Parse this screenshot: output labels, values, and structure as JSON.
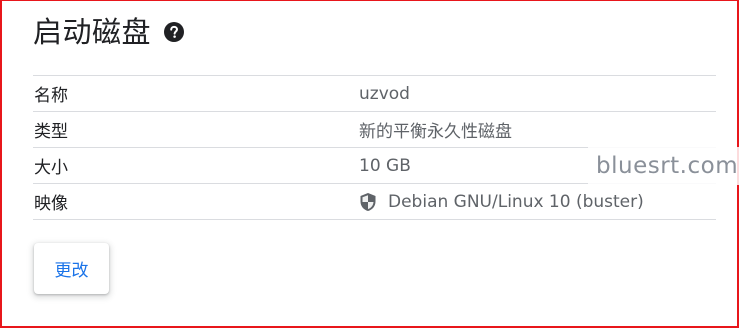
{
  "header": {
    "title": "启动磁盘",
    "help_icon": "help-circle-icon"
  },
  "disk": {
    "rows": [
      {
        "label": "名称",
        "value": "uzvod"
      },
      {
        "label": "类型",
        "value": "新的平衡永久性磁盘"
      },
      {
        "label": "大小",
        "value": "10 GB"
      },
      {
        "label": "映像",
        "value": "Debian GNU/Linux 10 (buster)",
        "icon": "shield-icon"
      }
    ]
  },
  "actions": {
    "edit_label": "更改"
  },
  "watermark": {
    "text": "bluesrt.com"
  },
  "colors": {
    "accent": "#1a73e8",
    "frame_border": "#e8161b",
    "divider": "#dadce0",
    "text_primary": "#202124",
    "text_secondary": "#5f6368"
  }
}
